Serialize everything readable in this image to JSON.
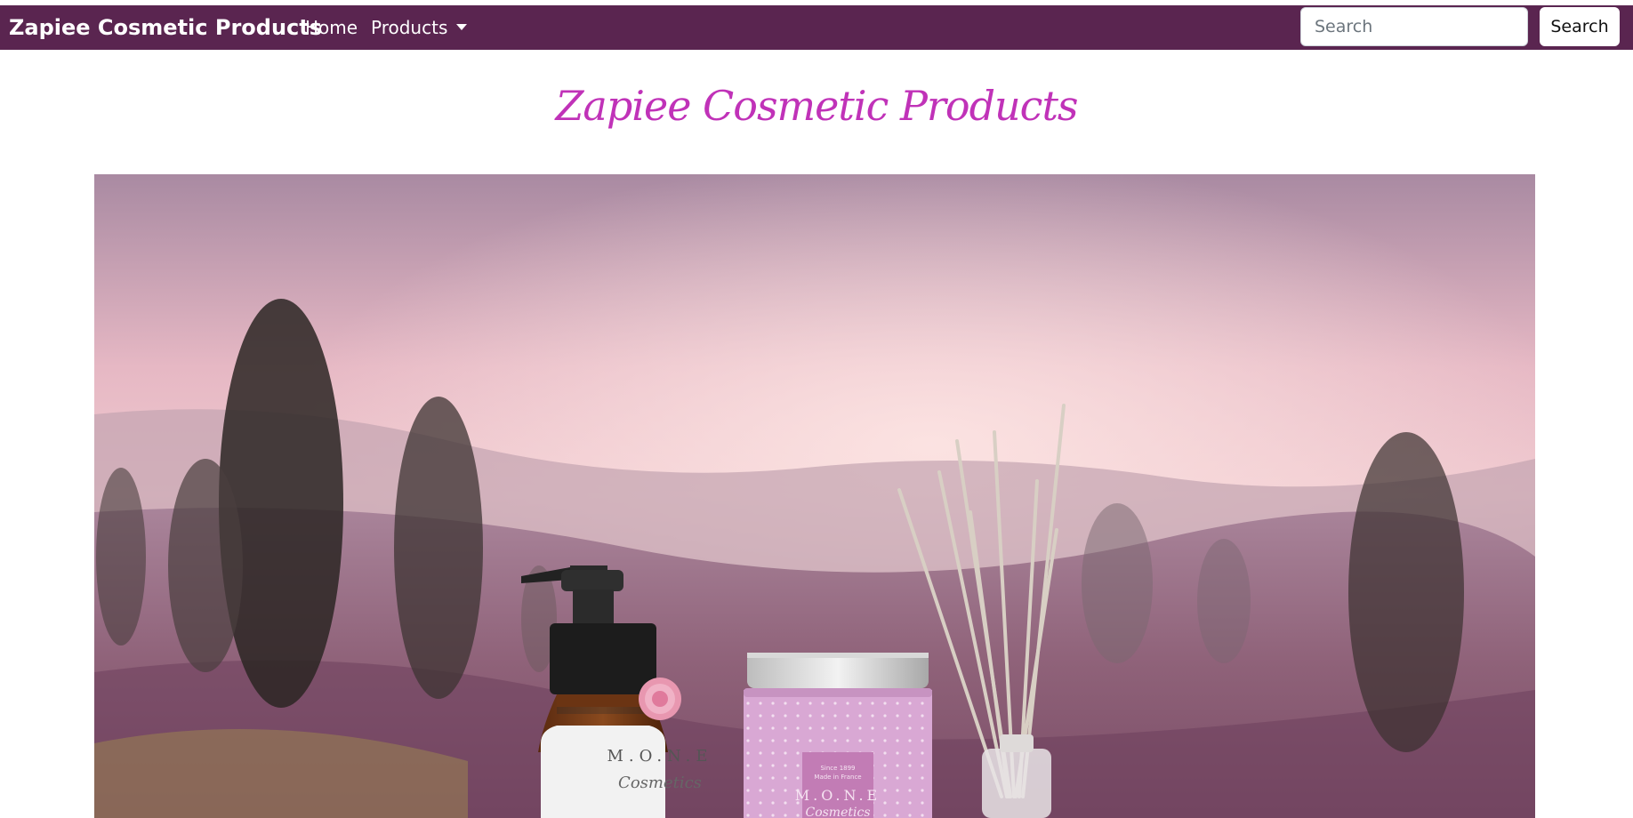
{
  "navbar": {
    "brand": "Zapiee Cosmetic Products",
    "links": [
      {
        "label": "Home"
      },
      {
        "label": "Products",
        "has_dropdown": true
      }
    ],
    "search": {
      "placeholder": "Search",
      "value": "",
      "button_label": "Search"
    },
    "background_color": "#5a2550"
  },
  "main": {
    "title": "Zapiee Cosmetic Products",
    "title_color": "#c032b8",
    "hero": {
      "products": [
        {
          "brand": "M.O.N.E",
          "subtitle": "Cosmetics"
        },
        {
          "brand": "M.O.N.E",
          "subtitle": "Cosmetics",
          "small_text": [
            "Since 1899",
            "Made in France"
          ]
        }
      ]
    }
  }
}
